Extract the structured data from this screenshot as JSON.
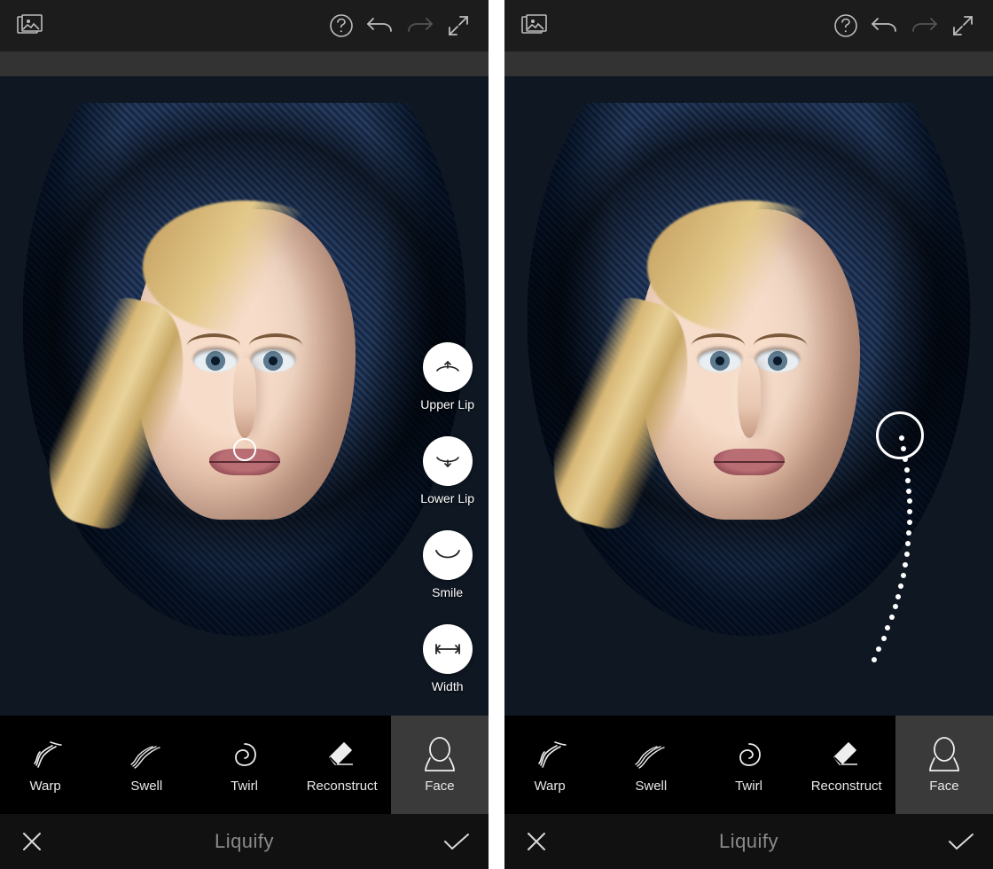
{
  "screenTitle": "Liquify",
  "tools": {
    "warp": "Warp",
    "swell": "Swell",
    "twirl": "Twirl",
    "reconstruct": "Reconstruct",
    "face": "Face"
  },
  "faceOptions": {
    "upperLip": "Upper Lip",
    "lowerLip": "Lower Lip",
    "smile": "Smile",
    "width": "Width"
  },
  "icons": {
    "gallery": "gallery",
    "help": "help",
    "undo": "undo",
    "redo": "redo",
    "fullscreen": "fullscreen",
    "cancel": "cancel",
    "confirm": "confirm"
  }
}
